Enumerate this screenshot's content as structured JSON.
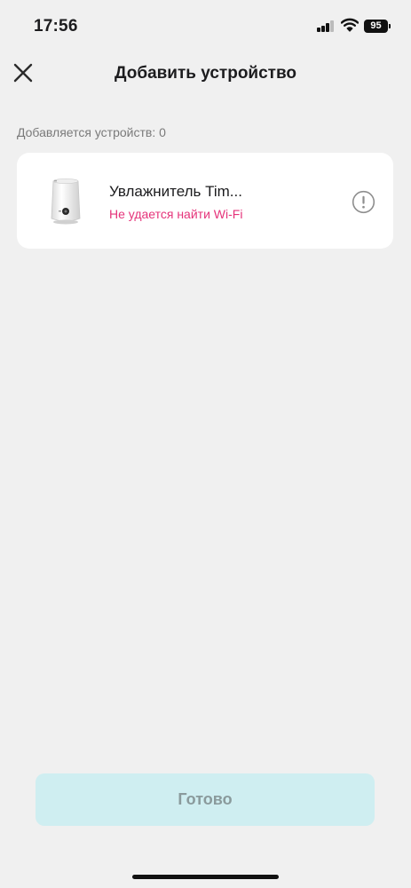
{
  "status_bar": {
    "time": "17:56",
    "battery": "95",
    "icons": [
      "signal-icon",
      "wifi-icon",
      "battery-icon"
    ]
  },
  "header": {
    "title": "Добавить устройство",
    "close_icon": "close-icon"
  },
  "main": {
    "count_label": "Добавляется устройств: 0",
    "devices": [
      {
        "name": "Увлажнитель Tim...",
        "status": "Не удается найти Wi-Fi",
        "status_color": "#e5337a",
        "icon": "warning-icon"
      }
    ]
  },
  "footer": {
    "done_label": "Готово",
    "done_bg": "#cfeef1"
  },
  "colors": {
    "background": "#f0f0f0",
    "card": "#ffffff",
    "error": "#e5337a"
  }
}
